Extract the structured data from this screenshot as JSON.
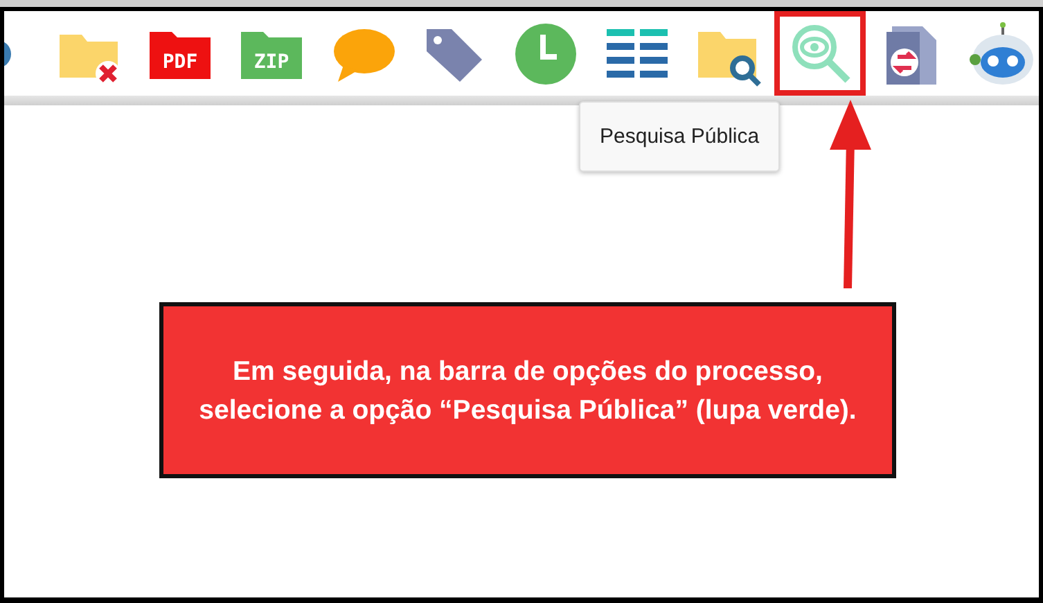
{
  "toolbar": {
    "icons": [
      {
        "kind": "partial-circle",
        "highlighted": false
      },
      {
        "kind": "folder-delete",
        "highlighted": false
      },
      {
        "kind": "file-label",
        "label": "PDF",
        "color": "#ee1111",
        "highlighted": false
      },
      {
        "kind": "file-label",
        "label": "ZIP",
        "color": "#5cb85c",
        "highlighted": false
      },
      {
        "kind": "speech",
        "highlighted": false
      },
      {
        "kind": "tag",
        "highlighted": false
      },
      {
        "kind": "clock",
        "highlighted": false
      },
      {
        "kind": "list",
        "highlighted": false
      },
      {
        "kind": "folder-search",
        "highlighted": false
      },
      {
        "kind": "eye-search",
        "highlighted": true
      },
      {
        "kind": "doc-arrows",
        "highlighted": false
      },
      {
        "kind": "robot",
        "highlighted": false
      }
    ]
  },
  "tooltip": {
    "text": "Pesquisa Pública"
  },
  "callout": {
    "text": "Em seguida, na barra de opções do processo, selecione a opção “Pesquisa Pública” (lupa verde)."
  }
}
